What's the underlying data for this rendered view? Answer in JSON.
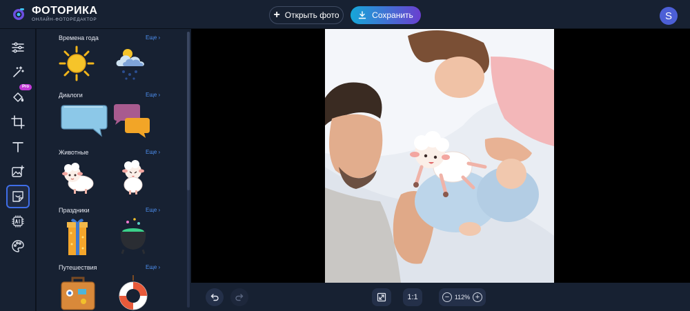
{
  "app": {
    "logo_title": "ФОТОРИКА",
    "logo_subtitle": "ОНЛАЙН-ФОТОРЕДАКТОР",
    "accent": "#3f6ee8",
    "pro_color": "#c23ad6"
  },
  "header": {
    "open_label": "Открыть фото",
    "save_label": "Сохранить",
    "avatar_letter": "S"
  },
  "toolbar": {
    "items": [
      {
        "name": "adjustments-icon"
      },
      {
        "name": "magic-wand-icon"
      },
      {
        "name": "paint-bucket-icon",
        "badge": "Pro"
      },
      {
        "name": "crop-icon"
      },
      {
        "name": "text-icon"
      },
      {
        "name": "image-add-icon"
      },
      {
        "name": "sticker-icon",
        "active": true
      },
      {
        "name": "ai-chip-icon"
      },
      {
        "name": "palette-icon"
      }
    ]
  },
  "stickers": {
    "sections": [
      {
        "title": "Времена года",
        "more": "Еще ›",
        "items": [
          "sun-sticker",
          "snow-cloud-sticker"
        ]
      },
      {
        "title": "Диалоги",
        "more": "Еще ›",
        "items": [
          "speech-bubble-sticker",
          "double-bubble-sticker"
        ]
      },
      {
        "title": "Животные",
        "more": "Еще ›",
        "items": [
          "sheep-sticker",
          "sheep-cheeky-sticker"
        ]
      },
      {
        "title": "Праздники",
        "more": "Еще ›",
        "items": [
          "gift-box-sticker",
          "cauldron-sticker"
        ]
      },
      {
        "title": "Путешествия",
        "more": "Еще ›",
        "items": [
          "suitcase-sticker",
          "life-ring-sticker"
        ]
      }
    ]
  },
  "canvas": {
    "image_semantic": "family-photo-with-sheep-sticker"
  },
  "bottom": {
    "fit_ratio_label": "1:1",
    "zoom_value": "112%",
    "zoom_out": "−",
    "zoom_in": "+"
  }
}
